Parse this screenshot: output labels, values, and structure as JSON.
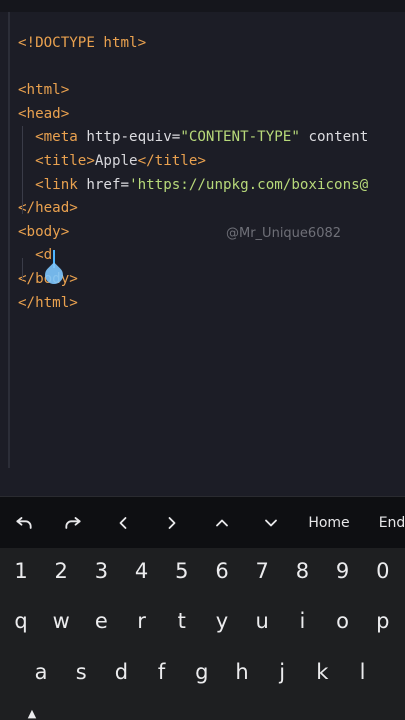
{
  "editor": {
    "lines": [
      {
        "id": "doctype",
        "parts": [
          {
            "t": "<!DOCTYPE html>",
            "c": "tag"
          }
        ]
      },
      {
        "id": "blank1",
        "parts": []
      },
      {
        "id": "html-open",
        "parts": [
          {
            "t": "<html>",
            "c": "tag"
          }
        ]
      },
      {
        "id": "head-open",
        "parts": [
          {
            "t": "<head>",
            "c": "tag"
          }
        ]
      },
      {
        "id": "meta",
        "parts": [
          {
            "t": "  <meta ",
            "c": "tag"
          },
          {
            "t": "http-equiv=",
            "c": "attr"
          },
          {
            "t": "\"CONTENT-TYPE\"",
            "c": "str"
          },
          {
            "t": " content",
            "c": "attr"
          }
        ]
      },
      {
        "id": "title",
        "parts": [
          {
            "t": "  <title>",
            "c": "tag"
          },
          {
            "t": "Apple",
            "c": "plain"
          },
          {
            "t": "</title>",
            "c": "tag"
          }
        ]
      },
      {
        "id": "link",
        "parts": [
          {
            "t": "  <link ",
            "c": "tag"
          },
          {
            "t": "href=",
            "c": "attr"
          },
          {
            "t": "'https://unpkg.com/boxicons@",
            "c": "str"
          }
        ]
      },
      {
        "id": "head-close",
        "parts": [
          {
            "t": "</head>",
            "c": "tag"
          }
        ]
      },
      {
        "id": "body-open",
        "parts": [
          {
            "t": "<body>",
            "c": "tag"
          }
        ]
      },
      {
        "id": "typing",
        "parts": [
          {
            "t": "  <d",
            "c": "tag"
          }
        ]
      },
      {
        "id": "body-close",
        "parts": [
          {
            "t": "</body>",
            "c": "tag"
          }
        ]
      },
      {
        "id": "html-close",
        "parts": [
          {
            "t": "</html>",
            "c": "tag"
          }
        ]
      }
    ],
    "watermark": "@Mr_Unique6082"
  },
  "toolbar": {
    "home_label": "Home",
    "end_label": "End"
  },
  "keyboard": {
    "numbers": [
      "1",
      "2",
      "3",
      "4",
      "5",
      "6",
      "7",
      "8",
      "9",
      "0"
    ],
    "row1": [
      "q",
      "w",
      "e",
      "r",
      "t",
      "y",
      "u",
      "i",
      "o",
      "p"
    ],
    "row2": [
      "a",
      "s",
      "d",
      "f",
      "g",
      "h",
      "j",
      "k",
      "l"
    ]
  },
  "colors": {
    "tag": "#e9a14f",
    "string": "#b7d97a",
    "attribute": "#dcdce0",
    "cursor": "#4fb6ff",
    "editor_bg": "#1c1d26",
    "keyboard_bg": "#1e1f21"
  }
}
